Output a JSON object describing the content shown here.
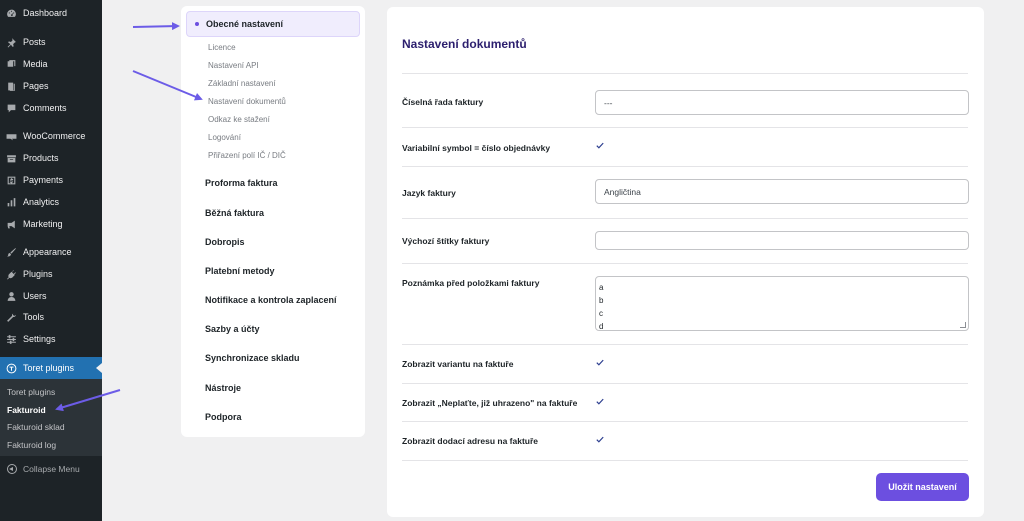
{
  "sidebar": {
    "items": [
      {
        "label": "Dashboard",
        "icon": "dashboard-icon"
      },
      {
        "label": "Posts",
        "icon": "pin-icon"
      },
      {
        "label": "Media",
        "icon": "media-icon"
      },
      {
        "label": "Pages",
        "icon": "pages-icon"
      },
      {
        "label": "Comments",
        "icon": "comment-icon"
      },
      {
        "label": "WooCommerce",
        "icon": "woocommerce-icon"
      },
      {
        "label": "Products",
        "icon": "products-icon"
      },
      {
        "label": "Payments",
        "icon": "dollar-icon"
      },
      {
        "label": "Analytics",
        "icon": "bar-chart-icon"
      },
      {
        "label": "Marketing",
        "icon": "megaphone-icon"
      },
      {
        "label": "Appearance",
        "icon": "brush-icon"
      },
      {
        "label": "Plugins",
        "icon": "plug-icon"
      },
      {
        "label": "Users",
        "icon": "user-icon"
      },
      {
        "label": "Tools",
        "icon": "wrench-icon"
      },
      {
        "label": "Settings",
        "icon": "sliders-icon"
      },
      {
        "label": "Toret plugins",
        "icon": "toret-logo-icon"
      }
    ],
    "submenu": [
      {
        "label": "Toret plugins"
      },
      {
        "label": "Fakturoid"
      },
      {
        "label": "Fakturoid sklad"
      },
      {
        "label": "Fakturoid log"
      }
    ],
    "collapse_label": "Collapse Menu"
  },
  "plugin_nav": {
    "active_label": "Obecné nastavení",
    "sub_items": [
      "Licence",
      "Nastavení API",
      "Základní nastavení",
      "Nastavení dokumentů",
      "Odkaz ke stažení",
      "Logování",
      "Přiřazení polí IČ / DIČ"
    ],
    "main_items": [
      "Proforma faktura",
      "Běžná faktura",
      "Dobropis",
      "Platební metody",
      "Notifikace a kontrola zaplacení",
      "Sazby a účty",
      "Synchronizace skladu",
      "Nástroje",
      "Podpora"
    ]
  },
  "content": {
    "title": "Nastavení dokumentů",
    "fields": {
      "number_series": {
        "label": "Číselná řada faktury",
        "value": "---"
      },
      "variable_symbol": {
        "label": "Variabilní symbol = číslo objednávky",
        "checked": true
      },
      "invoice_language": {
        "label": "Jazyk faktury",
        "value": "Angličtina"
      },
      "default_tags": {
        "label": "Výchozí štítky faktury",
        "value": ""
      },
      "note_before_items": {
        "label": "Poznámka před položkami faktury",
        "lines": [
          "a",
          "b",
          "c",
          "d"
        ]
      },
      "show_variant": {
        "label": "Zobrazit variantu na faktuře",
        "checked": true
      },
      "show_paid_notice": {
        "label": "Zobrazit „Neplaťte, již uhrazeno\" na faktuře",
        "checked": true
      },
      "show_delivery_address": {
        "label": "Zobrazit dodací adresu na faktuře",
        "checked": true
      }
    },
    "save_label": "Uložit nastavení"
  },
  "colors": {
    "accent": "#6c4fe0",
    "title": "#2c1f6e",
    "wp_sidebar": "#1d2327",
    "wp_active": "#2271b1"
  }
}
